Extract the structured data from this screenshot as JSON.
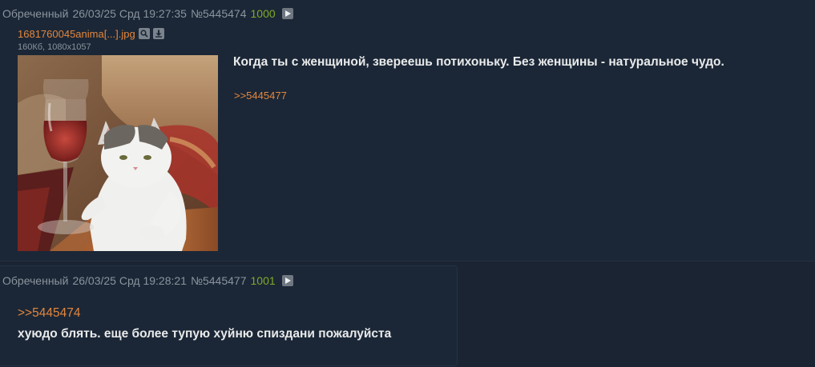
{
  "post1": {
    "name": "Обреченный",
    "date": "26/03/25 Срд 19:27:35",
    "number": "№5445474",
    "counter": "1000",
    "file_name": "1681760045anima[...].jpg",
    "file_info": "160Кб, 1080x1057",
    "message": "Когда ты с женщиной, звереешь потихоньку. Без женщины - натуральное чудо.",
    "reply_link": ">>5445477"
  },
  "post2": {
    "name": "Обреченный",
    "date": "26/03/25 Срд 19:28:21",
    "number": "№5445477",
    "counter": "1001",
    "quote_link": ">>5445474",
    "message": "хуюдо блять. еще более тупую хуйню спиздани пожалуйста"
  },
  "colors": {
    "background": "#1a2432",
    "post_bg": "#1b2736",
    "link": "#e4863c",
    "counter": "#80a82a",
    "text": "#e9eaeb",
    "meta": "#8b949e"
  },
  "icons": [
    "play-icon",
    "search-icon",
    "download-icon"
  ]
}
